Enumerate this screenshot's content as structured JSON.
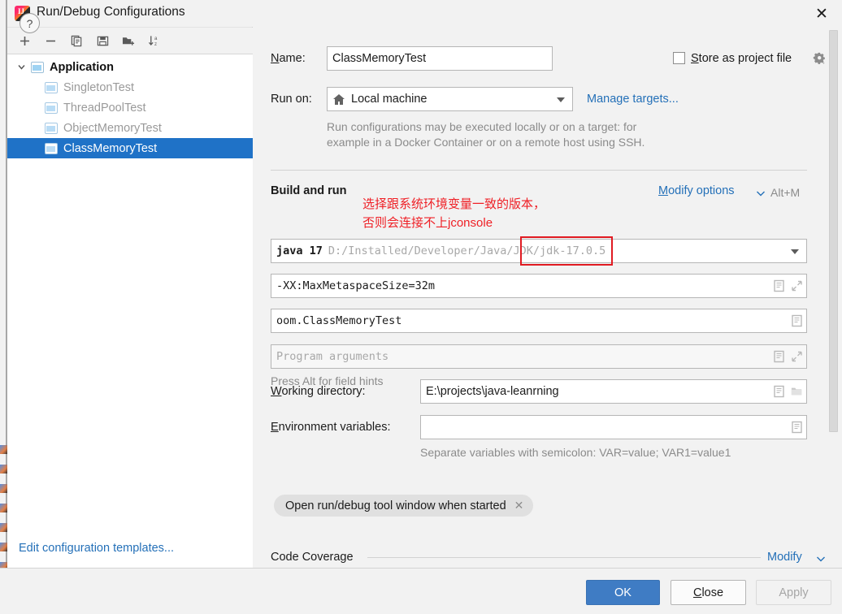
{
  "window": {
    "title": "Run/Debug Configurations",
    "app_icon": "intellij-idea-icon",
    "close_icon": "✕"
  },
  "toolbar": {
    "buttons": [
      {
        "name": "add-configuration-button",
        "icon": "plus-icon"
      },
      {
        "name": "remove-configuration-button",
        "icon": "minus-icon"
      },
      {
        "name": "copy-configuration-button",
        "icon": "copy-icon"
      },
      {
        "name": "save-configuration-button",
        "icon": "save-icon"
      },
      {
        "name": "move-into-folder-button",
        "icon": "folder-add-icon"
      },
      {
        "name": "sort-configurations-button",
        "icon": "sort-alphabetically-icon"
      }
    ]
  },
  "tree": {
    "group_label": "Application",
    "items": [
      {
        "label": "SingletonTest",
        "selected": false
      },
      {
        "label": "ThreadPoolTest",
        "selected": false
      },
      {
        "label": "ObjectMemoryTest",
        "selected": false
      },
      {
        "label": "ClassMemoryTest",
        "selected": true
      }
    ],
    "templates_link": "Edit configuration templates..."
  },
  "form": {
    "name_label": "Name:",
    "name_label_mnemonic": "N",
    "name_value": "ClassMemoryTest",
    "store_as_project_file_label": "Store as project file",
    "store_as_project_file_mnemonic": "S",
    "store_as_project_file_checked": false,
    "store_gear_icon": "gear-dropdown-icon",
    "run_on_label": "Run on:",
    "run_on_value": "Local machine",
    "run_on_icon": "home-icon",
    "manage_targets_link": "Manage targets...",
    "run_on_hint_line1": "Run configurations may be executed locally or on a target: for",
    "run_on_hint_line2": "example in a Docker Container or on a remote host using SSH.",
    "build_and_run_title": "Build and run",
    "modify_options_link": "Modify options",
    "modify_options_mnemonic": "M",
    "modify_options_shortcut": "Alt+M",
    "jdk_value": "java 17",
    "jdk_path": "D:/Installed/Developer/Java/JDK/jdk-17.0.5",
    "vm_options_value": "-XX:MaxMetaspaceSize=32m",
    "main_class_value": "oom.ClassMemoryTest",
    "program_arguments_placeholder": "Program arguments",
    "field_hints": "Press Alt for field hints",
    "working_directory_label": "Working directory:",
    "working_directory_mnemonic": "W",
    "working_directory_value": "E:\\projects\\java-leanrning",
    "environment_variables_label": "Environment variables:",
    "environment_variables_mnemonic": "E",
    "environment_variables_value": "",
    "environment_variables_hint": "Separate variables with semicolon: VAR=value; VAR1=value1",
    "tag_chip_label": "Open run/debug tool window when started",
    "tag_chip_remove_icon": "✕",
    "code_coverage_title": "Code Coverage",
    "code_coverage_modify_link": "Modify"
  },
  "annotation": {
    "line1": "选择跟系统环境变量一致的版本，",
    "line2": "否则会连接不上jconsole",
    "color": "#ef1f25",
    "highlight_box_color": "#e01b22"
  },
  "footer": {
    "help_icon": "?",
    "ok_label": "OK",
    "close_label": "Close",
    "close_mnemonic": "C",
    "apply_label": "Apply",
    "apply_disabled": true
  },
  "colors": {
    "selection": "#1f72c7",
    "link": "#2470b8",
    "primary_button": "#3f7cc4",
    "panel_bg": "#f2f2f2",
    "field_bg": "#ffffff"
  }
}
